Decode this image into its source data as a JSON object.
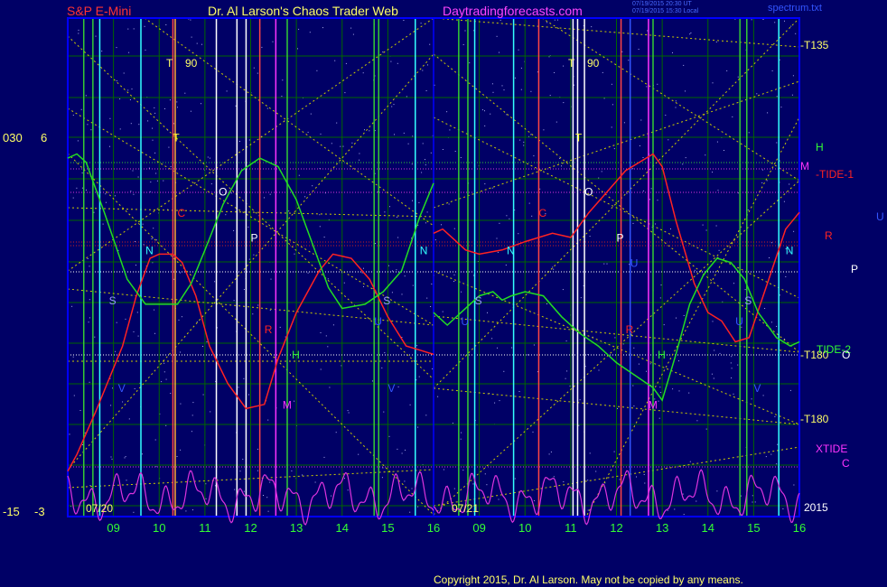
{
  "header": {
    "symbol": "S&P E-Mini",
    "site": "Dr. Al Larson's Chaos Trader Web",
    "url": "Daytradingforecasts.com",
    "stamp_line1": "07/19/2015 20:30 UT",
    "stamp_line2": "07/19/2015 15:30 Local",
    "filename": "spectrum.txt"
  },
  "footer": {
    "copyright": "Copyright 2015, Dr. Al Larson. May not be copied by any means."
  },
  "colors": {
    "background": "#000066",
    "frame": "#0000ff",
    "grid": "#006600",
    "price_line": "#ff2222",
    "tide_line": "#22dd22",
    "xtide_line": "#dd33dd",
    "fib_lines": "#cccc00"
  },
  "left_axis": {
    "top_left": "030",
    "top_right": "6",
    "bottom_left": "-15",
    "bottom_right": "-3"
  },
  "right_labels": {
    "t135": "-T135",
    "h": "H",
    "m": "M",
    "tide1": "-TIDE-1",
    "u": "U",
    "r": "R",
    "p": "P",
    "t180_upper": "-T180",
    "tide2": "TIDE-2",
    "o": "O",
    "t180_lower": "-T180",
    "xtide": "XTIDE",
    "c": "C",
    "year": "2015"
  },
  "panels": [
    {
      "date": "07/20",
      "t_label": "T",
      "t_value": "90"
    },
    {
      "date": "07/21",
      "t_label": "T",
      "t_value": "90"
    }
  ],
  "chart_data": {
    "type": "line",
    "title": "S&P E-Mini",
    "x_tick_labels": [
      "09",
      "10",
      "11",
      "12",
      "13",
      "14",
      "15",
      "16",
      "09",
      "10",
      "11",
      "12",
      "13",
      "14",
      "15",
      "16"
    ],
    "y_left_top": 6,
    "y_left_bottom": -3,
    "series": [
      {
        "name": "price",
        "days": [
          [
            [
              8.0,
              -2.0
            ],
            [
              8.2,
              -1.6
            ],
            [
              8.6,
              -0.6
            ],
            [
              9.2,
              1.0
            ],
            [
              9.5,
              2.2
            ],
            [
              9.8,
              3.1
            ],
            [
              10.0,
              3.2
            ],
            [
              10.3,
              3.2
            ],
            [
              10.5,
              3.0
            ],
            [
              10.8,
              2.2
            ],
            [
              11.1,
              1.0
            ],
            [
              11.5,
              0.1
            ],
            [
              11.9,
              -0.5
            ],
            [
              12.3,
              -0.4
            ],
            [
              12.6,
              0.7
            ],
            [
              13.0,
              1.8
            ],
            [
              13.5,
              2.8
            ],
            [
              13.8,
              3.2
            ],
            [
              14.2,
              3.1
            ],
            [
              14.6,
              2.6
            ],
            [
              15.0,
              1.7
            ],
            [
              15.4,
              1.0
            ],
            [
              15.7,
              0.9
            ],
            [
              16.0,
              0.8
            ]
          ],
          [
            [
              8.0,
              3.7
            ],
            [
              8.2,
              3.8
            ],
            [
              8.4,
              3.6
            ],
            [
              8.7,
              3.3
            ],
            [
              9.0,
              3.2
            ],
            [
              9.5,
              3.3
            ],
            [
              10.0,
              3.5
            ],
            [
              10.6,
              3.7
            ],
            [
              11.0,
              3.6
            ],
            [
              11.4,
              4.2
            ],
            [
              11.8,
              4.7
            ],
            [
              12.2,
              5.2
            ],
            [
              12.8,
              5.6
            ],
            [
              13.0,
              5.3
            ],
            [
              13.3,
              4.0
            ],
            [
              13.7,
              2.5
            ],
            [
              14.0,
              1.8
            ],
            [
              14.3,
              1.6
            ],
            [
              14.6,
              1.1
            ],
            [
              14.9,
              1.2
            ],
            [
              15.3,
              2.5
            ],
            [
              15.7,
              3.8
            ],
            [
              16.0,
              4.2
            ]
          ]
        ]
      },
      {
        "name": "TIDE",
        "days": [
          [
            [
              8.0,
              5.5
            ],
            [
              8.2,
              5.6
            ],
            [
              8.4,
              5.4
            ],
            [
              8.8,
              4.2
            ],
            [
              9.3,
              2.6
            ],
            [
              9.7,
              2.0
            ],
            [
              10.1,
              2.0
            ],
            [
              10.4,
              2.0
            ],
            [
              10.7,
              2.5
            ],
            [
              11.0,
              3.3
            ],
            [
              11.4,
              4.4
            ],
            [
              11.8,
              5.2
            ],
            [
              12.2,
              5.5
            ],
            [
              12.6,
              5.3
            ],
            [
              13.0,
              4.5
            ],
            [
              13.4,
              3.3
            ],
            [
              13.7,
              2.4
            ],
            [
              14.0,
              1.9
            ],
            [
              14.5,
              2.0
            ],
            [
              14.9,
              2.3
            ],
            [
              15.3,
              2.8
            ],
            [
              15.7,
              4.1
            ],
            [
              16.0,
              4.9
            ]
          ],
          [
            [
              8.0,
              1.8
            ],
            [
              8.3,
              1.5
            ],
            [
              8.6,
              1.8
            ],
            [
              9.0,
              2.2
            ],
            [
              9.3,
              2.3
            ],
            [
              9.5,
              2.1
            ],
            [
              9.7,
              2.2
            ],
            [
              10.0,
              2.3
            ],
            [
              10.4,
              2.2
            ],
            [
              10.8,
              1.7
            ],
            [
              11.2,
              1.3
            ],
            [
              11.6,
              1.0
            ],
            [
              12.0,
              0.6
            ],
            [
              12.4,
              0.3
            ],
            [
              12.8,
              0.0
            ],
            [
              13.0,
              -0.3
            ],
            [
              13.3,
              0.8
            ],
            [
              13.6,
              2.0
            ],
            [
              13.9,
              2.7
            ],
            [
              14.2,
              3.1
            ],
            [
              14.5,
              3.0
            ],
            [
              14.8,
              2.6
            ],
            [
              15.1,
              1.8
            ],
            [
              15.5,
              1.2
            ],
            [
              15.8,
              1.0
            ],
            [
              16.0,
              1.1
            ]
          ]
        ]
      },
      {
        "name": "XTIDE",
        "amplitude": 0.55,
        "base": -2.6
      }
    ],
    "letter_marks": [
      {
        "t": "T",
        "d": 0,
        "x": 10.3,
        "y": 5.9,
        "c": "#ffff33"
      },
      {
        "t": "O",
        "d": 0,
        "x": 11.3,
        "y": 4.6,
        "c": "#ffffff"
      },
      {
        "t": "C",
        "d": 0,
        "x": 10.4,
        "y": 4.1,
        "c": "#ff2222"
      },
      {
        "t": "P",
        "d": 0,
        "x": 12.0,
        "y": 3.5,
        "c": "#ffffff"
      },
      {
        "t": "N",
        "d": 0,
        "x": 9.7,
        "y": 3.2,
        "c": "#33ffff"
      },
      {
        "t": "S",
        "d": 0,
        "x": 8.9,
        "y": 2.0,
        "c": "#9999ff"
      },
      {
        "t": "R",
        "d": 0,
        "x": 12.3,
        "y": 1.3,
        "c": "#ff2222"
      },
      {
        "t": "H",
        "d": 0,
        "x": 12.9,
        "y": 0.7,
        "c": "#33ff33"
      },
      {
        "t": "M",
        "d": 0,
        "x": 12.7,
        "y": -0.5,
        "c": "#ff33ff"
      },
      {
        "t": "V",
        "d": 0,
        "x": 9.1,
        "y": -0.1,
        "c": "#3355ff"
      },
      {
        "t": "S",
        "d": 0,
        "x": 14.9,
        "y": 2.0,
        "c": "#9999ff"
      },
      {
        "t": "N",
        "d": 0,
        "x": 15.7,
        "y": 3.2,
        "c": "#33ffff"
      },
      {
        "t": "V",
        "d": 0,
        "x": 15.0,
        "y": -0.1,
        "c": "#3355ff"
      },
      {
        "t": "U",
        "d": 0,
        "x": 14.7,
        "y": 1.5,
        "c": "#3355ff"
      },
      {
        "t": "T",
        "d": 1,
        "x": 11.1,
        "y": 5.9,
        "c": "#ffff33"
      },
      {
        "t": "O",
        "d": 1,
        "x": 11.3,
        "y": 4.6,
        "c": "#ffffff"
      },
      {
        "t": "C",
        "d": 1,
        "x": 10.3,
        "y": 4.1,
        "c": "#ff2222"
      },
      {
        "t": "P",
        "d": 1,
        "x": 12.0,
        "y": 3.5,
        "c": "#ffffff"
      },
      {
        "t": "N",
        "d": 1,
        "x": 9.6,
        "y": 3.2,
        "c": "#33ffff"
      },
      {
        "t": "S",
        "d": 1,
        "x": 8.9,
        "y": 2.0,
        "c": "#9999ff"
      },
      {
        "t": "U",
        "d": 1,
        "x": 12.3,
        "y": 2.9,
        "c": "#3355ff"
      },
      {
        "t": "R",
        "d": 1,
        "x": 12.2,
        "y": 1.3,
        "c": "#ff2222"
      },
      {
        "t": "H",
        "d": 1,
        "x": 12.9,
        "y": 0.7,
        "c": "#33ff33"
      },
      {
        "t": "M",
        "d": 1,
        "x": 12.7,
        "y": -0.5,
        "c": "#ff33ff"
      },
      {
        "t": "S",
        "d": 1,
        "x": 14.8,
        "y": 2.0,
        "c": "#9999ff"
      },
      {
        "t": "U",
        "d": 1,
        "x": 14.6,
        "y": 1.5,
        "c": "#3355ff"
      },
      {
        "t": "N",
        "d": 1,
        "x": 15.7,
        "y": 3.2,
        "c": "#33ffff"
      },
      {
        "t": "V",
        "d": 1,
        "x": 15.0,
        "y": -0.1,
        "c": "#3355ff"
      },
      {
        "t": "U",
        "d": 1,
        "x": 8.6,
        "y": 1.5,
        "c": "#3355ff"
      }
    ]
  }
}
